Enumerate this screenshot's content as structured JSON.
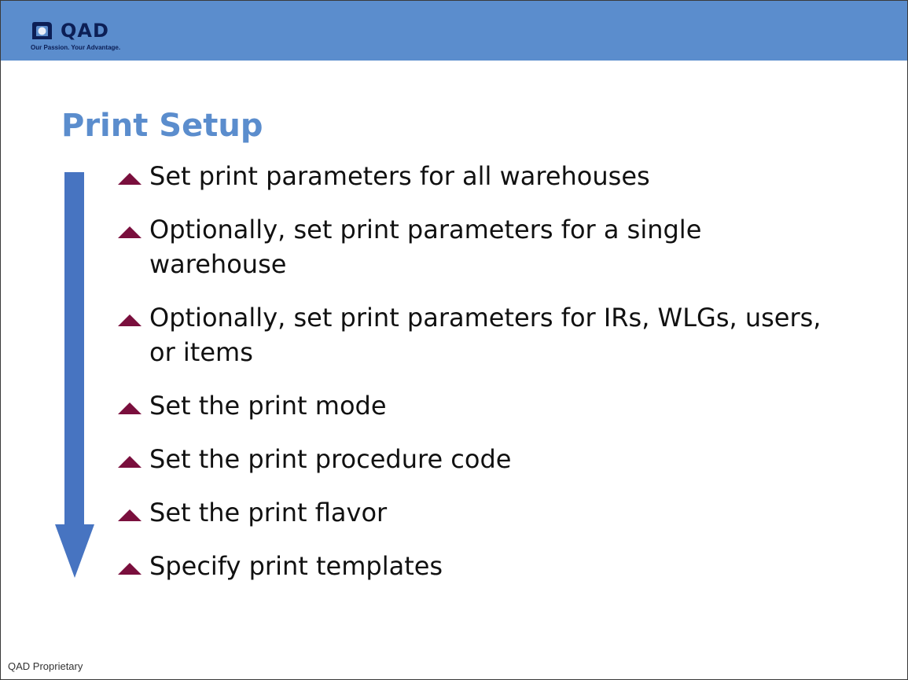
{
  "header": {
    "logo": {
      "wordmark": "QAD",
      "tagline": "Our Passion. Your Advantage.",
      "icon": "qad-logo-icon"
    },
    "band_color": "#5b8dcd"
  },
  "slide": {
    "title": "Print Setup",
    "title_color": "#5b8dcd",
    "flow_arrow": {
      "icon": "down-arrow-icon",
      "color": "#4774c1"
    },
    "bullet_icon": "triangle-bullet-icon",
    "bullet_color": "#7a0f3d",
    "bullets": [
      "Set print parameters for all warehouses",
      "Optionally, set print parameters for a single warehouse",
      "Optionally, set print parameters for IRs, WLGs, users, or items",
      "Set the print mode",
      "Set the print procedure code",
      "Set the print flavor",
      "Specify print templates"
    ]
  },
  "footer": {
    "text": "QAD Proprietary"
  }
}
